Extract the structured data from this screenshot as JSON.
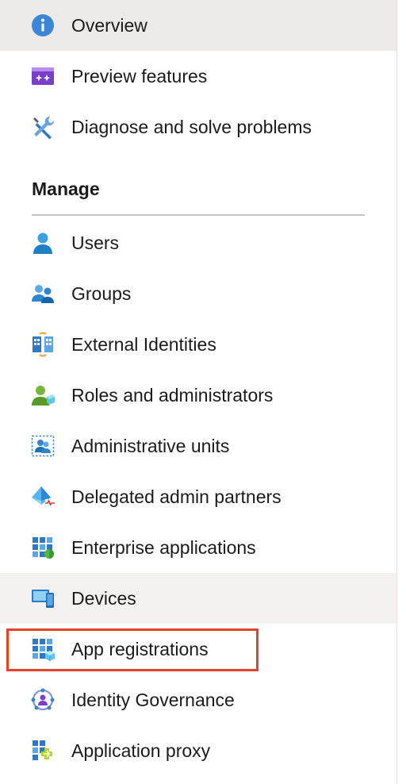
{
  "nav": {
    "items": [
      {
        "label": "Overview",
        "icon": "info-icon"
      },
      {
        "label": "Preview features",
        "icon": "preview-features-icon"
      },
      {
        "label": "Diagnose and solve problems",
        "icon": "wrench-screwdriver-icon"
      }
    ],
    "manage": {
      "heading": "Manage",
      "items": [
        {
          "label": "Users",
          "icon": "user-icon"
        },
        {
          "label": "Groups",
          "icon": "groups-icon"
        },
        {
          "label": "External Identities",
          "icon": "external-identities-icon"
        },
        {
          "label": "Roles and administrators",
          "icon": "roles-icon"
        },
        {
          "label": "Administrative units",
          "icon": "administrative-units-icon"
        },
        {
          "label": "Delegated admin partners",
          "icon": "delegated-admin-icon"
        },
        {
          "label": "Enterprise applications",
          "icon": "enterprise-apps-icon"
        },
        {
          "label": "Devices",
          "icon": "devices-icon"
        },
        {
          "label": "App registrations",
          "icon": "app-registrations-icon"
        },
        {
          "label": "Identity Governance",
          "icon": "identity-governance-icon"
        },
        {
          "label": "Application proxy",
          "icon": "application-proxy-icon"
        }
      ]
    },
    "active_item": "Overview",
    "hovered_item": "Devices",
    "highlighted_item": "App registrations"
  },
  "colors": {
    "active_bg": "#edebe9",
    "hover_bg": "#f3f2f1",
    "highlight_border": "#e0452b",
    "azure_blue": "#0078d4"
  }
}
